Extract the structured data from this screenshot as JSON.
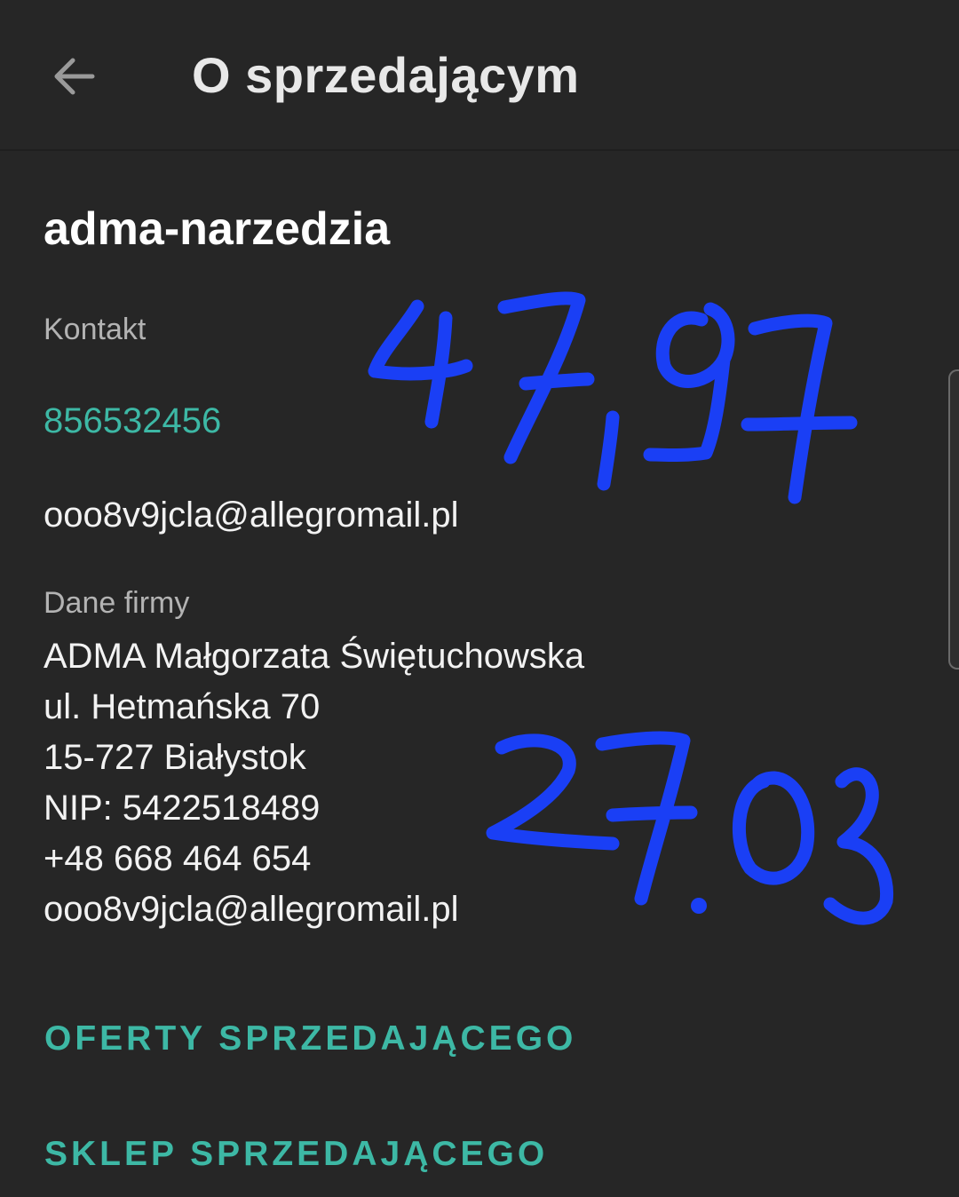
{
  "app_bar": {
    "title": "O sprzedającym",
    "back_icon": "arrow-left-icon"
  },
  "seller": {
    "name": "adma-narzedzia"
  },
  "contact": {
    "label": "Kontakt",
    "phone": "856532456",
    "email": "ooo8v9jcla@allegromail.pl"
  },
  "company": {
    "label": "Dane firmy",
    "lines": [
      "ADMA Małgorzata Świętuchowska",
      "ul. Hetmańska 70",
      "15-727 Białystok",
      "NIP: 5422518489",
      "+48 668 464 654",
      "ooo8v9jcla@allegromail.pl"
    ]
  },
  "actions": {
    "offers": "OFERTY SPRZEDAJĄCEGO",
    "shop": "SKLEP SPRZEDAJĄCEGO"
  },
  "handwriting": {
    "color": "#1a3ff5",
    "note_top": "47,97",
    "note_bottom": "27.03"
  },
  "colors": {
    "background": "#262626",
    "accent": "#3db8a5",
    "text_primary": "#f2f2f2",
    "text_secondary": "#b3b3b3"
  }
}
